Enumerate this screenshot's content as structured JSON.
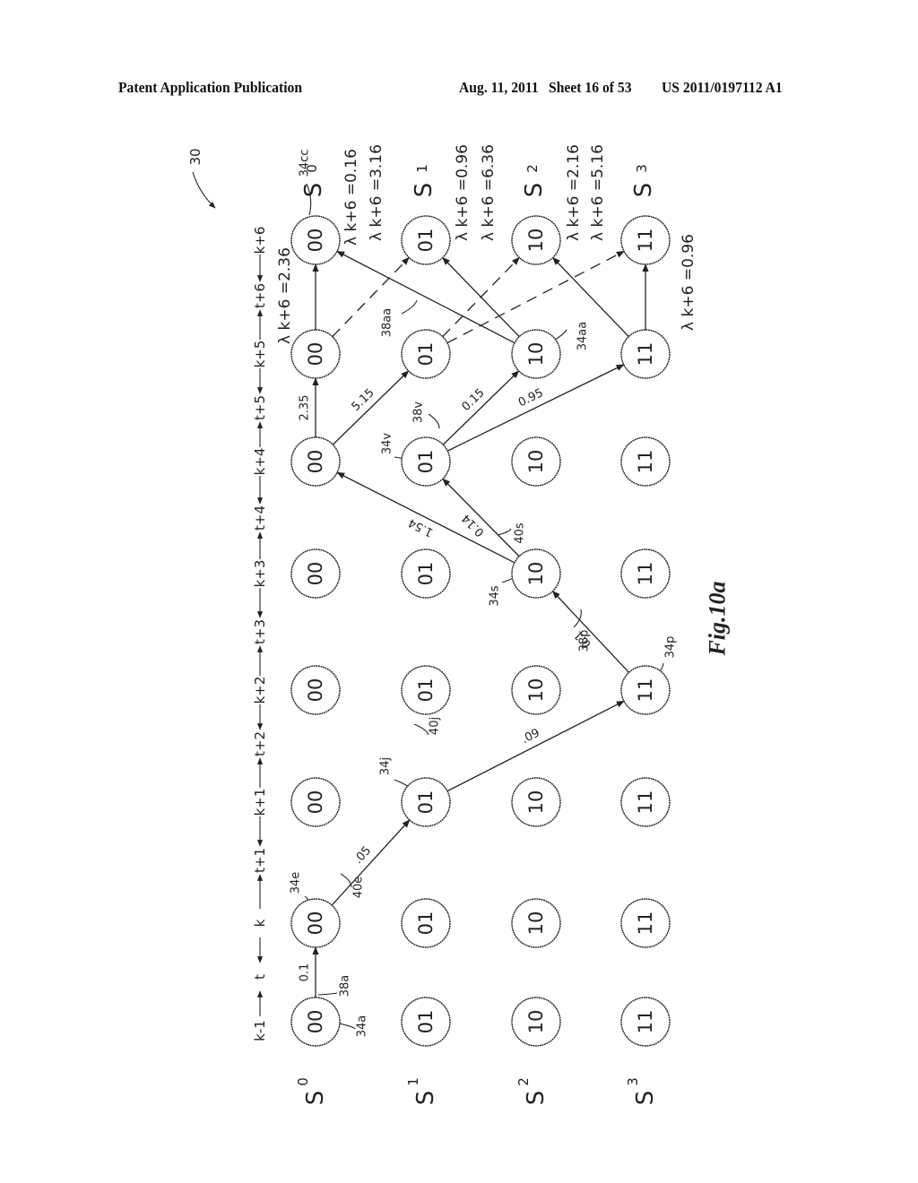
{
  "header": {
    "publication": "Patent Application Publication",
    "date": "Aug. 11, 2011",
    "sheet": "Sheet 16 of 53",
    "number": "US 2011/0197112 A1"
  },
  "figure": {
    "label": "Fig.10a",
    "reference": "30",
    "state_labels": [
      {
        "id": "S0",
        "text": "S",
        "sub": "0"
      },
      {
        "id": "S1",
        "text": "S",
        "sub": "1"
      },
      {
        "id": "S2",
        "text": "S",
        "sub": "2"
      },
      {
        "id": "S3",
        "text": "S",
        "sub": "3"
      }
    ],
    "time_axis": [
      "k-1",
      "t",
      "k",
      "t+1",
      "k+1",
      "t+2",
      "k+2",
      "t+3",
      "k+3",
      "t+4",
      "k+4",
      "t+5",
      "k+5",
      "t+6",
      "k+6"
    ],
    "node_states": [
      "00",
      "01",
      "10",
      "11"
    ],
    "final_state_labels": [
      "S0",
      "S1",
      "S2",
      "S3"
    ],
    "edges": [
      {
        "from": "k-1:00",
        "to": "k:00",
        "metric": "0.1",
        "style": "solid",
        "ref": "38a"
      },
      {
        "from": "k:00",
        "to": "k+1:01",
        "metric": ".05",
        "style": "solid",
        "ref": "40e"
      },
      {
        "from": "k+1:01",
        "to": "k+2:11",
        "metric": ".09",
        "style": "solid",
        "ref": "40j"
      },
      {
        "from": "k+2:11",
        "to": "k+3:10",
        "metric": "0.1",
        "style": "solid",
        "ref": "38p"
      },
      {
        "from": "k+3:10",
        "to": "k+4:00",
        "metric": "1.54",
        "style": "solid",
        "ref": ""
      },
      {
        "from": "k+3:10",
        "to": "k+4:01",
        "metric": "0.14",
        "style": "solid",
        "ref": "40s"
      },
      {
        "from": "k+4:00",
        "to": "k+5:00",
        "metric": "2.35",
        "style": "solid",
        "ref": ""
      },
      {
        "from": "k+4:00",
        "to": "k+5:01",
        "metric": "5.15",
        "style": "solid",
        "ref": ""
      },
      {
        "from": "k+4:01",
        "to": "k+5:10",
        "metric": "0.15",
        "style": "solid",
        "ref": "38v"
      },
      {
        "from": "k+4:01",
        "to": "k+5:11",
        "metric": "0.95",
        "style": "solid",
        "ref": ""
      },
      {
        "from": "k+5:00",
        "to": "k+6:00",
        "metric": "",
        "style": "solid",
        "ref": ""
      },
      {
        "from": "k+5:00",
        "to": "k+6:01",
        "metric": "",
        "style": "dashed",
        "ref": ""
      },
      {
        "from": "k+5:10",
        "to": "k+6:00",
        "metric": "",
        "style": "solid",
        "ref": "38aa"
      },
      {
        "from": "k+5:10",
        "to": "k+6:01",
        "metric": "",
        "style": "solid",
        "ref": ""
      },
      {
        "from": "k+5:01",
        "to": "k+6:10",
        "metric": "",
        "style": "dashed",
        "ref": ""
      },
      {
        "from": "k+5:11",
        "to": "k+6:10",
        "metric": "",
        "style": "solid",
        "ref": ""
      },
      {
        "from": "k+5:01",
        "to": "k+6:11",
        "metric": "",
        "style": "dashed",
        "ref": ""
      },
      {
        "from": "k+5:11",
        "to": "k+6:11",
        "metric": "",
        "style": "solid",
        "ref": ""
      }
    ],
    "lambda_labels": [
      {
        "text": "λ k+6 =2.36"
      },
      {
        "text": "λ k+6 =0.16"
      },
      {
        "text": "λ k+6 =3.16"
      },
      {
        "text": "λ k+6 =0.96"
      },
      {
        "text": "λ k+6 =6.36"
      },
      {
        "text": "λ k+6 =2.16"
      },
      {
        "text": "λ k+6 =5.16"
      },
      {
        "text": "λ k+6 =0.96"
      }
    ],
    "node_refs": [
      "34a",
      "34e",
      "34j",
      "34p",
      "34s",
      "34v",
      "34aa",
      "34cc"
    ],
    "edge_refs": [
      "38a",
      "40e",
      "40j",
      "38p",
      "40s",
      "38v",
      "38aa"
    ]
  }
}
